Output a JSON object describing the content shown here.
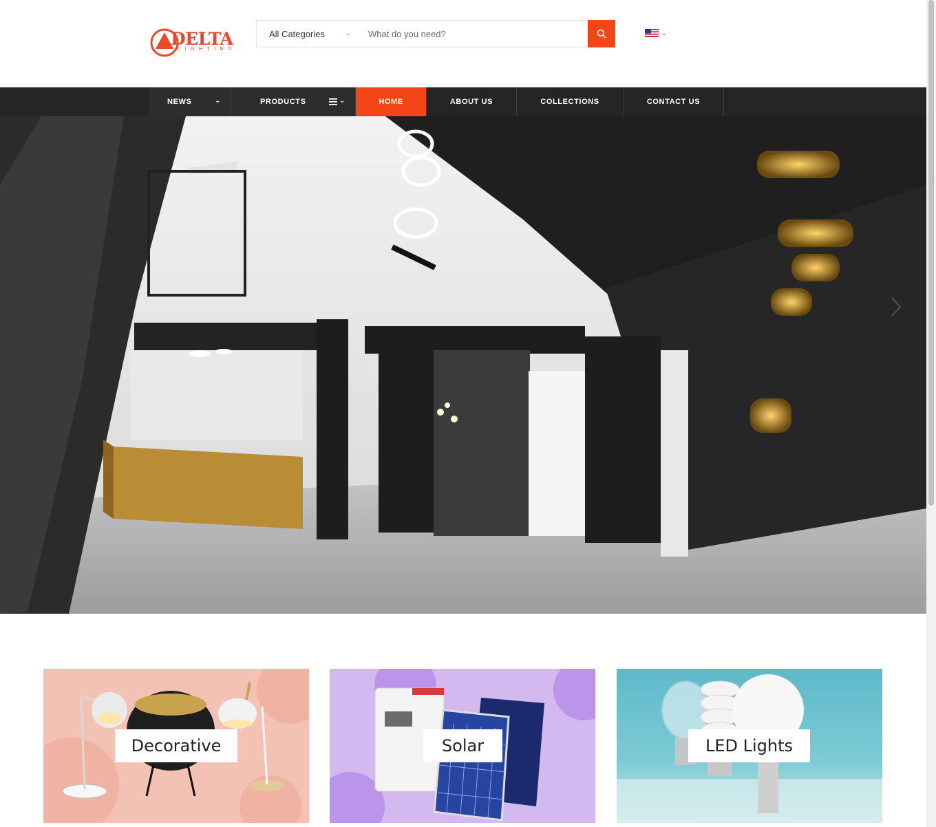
{
  "brand": {
    "name": "DELTA",
    "tagline": "LIGHTING",
    "color": "#e8492a"
  },
  "search": {
    "category_value": "All Categories",
    "placeholder": "What do you need?",
    "button_icon": "search-icon",
    "accent": "#f44517"
  },
  "language": {
    "flag": "us-flag-icon"
  },
  "nav": {
    "items": [
      {
        "label": "NEWS",
        "has_dropdown": true
      },
      {
        "label": "PRODUCTS",
        "has_dropdown": true,
        "icon": "menu-icon"
      },
      {
        "label": "HOME",
        "active": true
      },
      {
        "label": "ABOUT US"
      },
      {
        "label": "COLLECTIONS"
      },
      {
        "label": "CONTACT US"
      }
    ],
    "bg": "#252525",
    "active_color": "#f44517"
  },
  "hero": {
    "prev_icon": "chevron-left-icon",
    "next_icon": "chevron-right-icon"
  },
  "categories": [
    {
      "label": "Decorative",
      "bg": "#f3c2b4"
    },
    {
      "label": "Solar",
      "bg": "#d3b9ef"
    },
    {
      "label": "LED Lights",
      "bg": "#5fb9c8"
    }
  ]
}
